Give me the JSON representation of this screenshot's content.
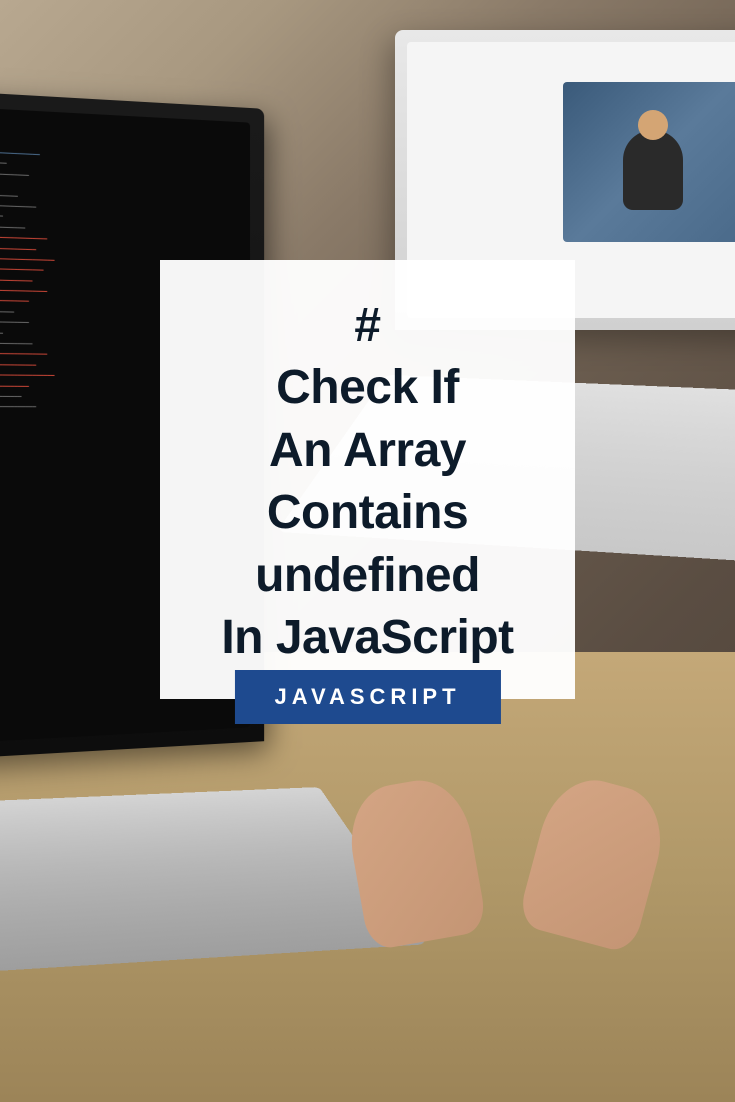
{
  "title": {
    "hash": "#",
    "line1": "Check If",
    "line2": "An Array",
    "line3": "Contains",
    "line4": "undefined",
    "line5": "In JavaScript"
  },
  "category": {
    "label": "JAVASCRIPT"
  }
}
